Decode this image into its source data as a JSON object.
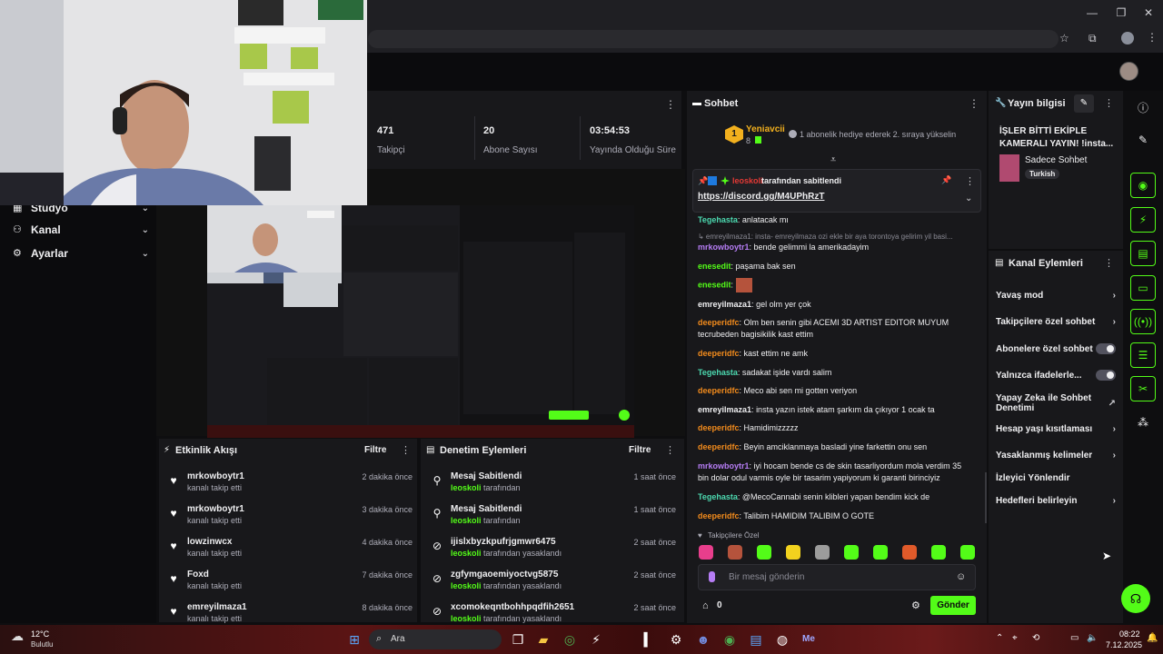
{
  "stats": [
    {
      "value": "471",
      "label": "Takipçi"
    },
    {
      "value": "20",
      "label": "Abone Sayısı"
    },
    {
      "value": "03:54:53",
      "label": "Yayında Olduğu Süre"
    }
  ],
  "sidebar": {
    "items": [
      {
        "label": "Stüdyo",
        "icon": "studio-icon"
      },
      {
        "label": "Kanal",
        "icon": "channel-icon"
      },
      {
        "label": "Ayarlar",
        "icon": "gear-icon"
      }
    ]
  },
  "activity": {
    "title": "Etkinlik Akışı",
    "filter": "Filtre",
    "rows": [
      {
        "user": "mrkowboytr1",
        "desc": "kanalı takip etti",
        "time": "2 dakika önce"
      },
      {
        "user": "mrkowboytr1",
        "desc": "kanalı takip etti",
        "time": "3 dakika önce"
      },
      {
        "user": "lowzinwcx",
        "desc": "kanalı takip etti",
        "time": "4 dakika önce"
      },
      {
        "user": "Foxd",
        "desc": "kanalı takip etti",
        "time": "7 dakika önce"
      },
      {
        "user": "emreyilmaza1",
        "desc": "kanalı takip etti",
        "time": "8 dakika önce"
      }
    ]
  },
  "moderation": {
    "title": "Denetim Eylemleri",
    "filter": "Filtre",
    "rows": [
      {
        "title": "Mesaj Sabitlendi",
        "by": "leoskoli",
        "suffix": "tarafından",
        "time": "1 saat önce",
        "icon": "pin-icon"
      },
      {
        "title": "Mesaj Sabitlendi",
        "by": "leoskoli",
        "suffix": "tarafından",
        "time": "1 saat önce",
        "icon": "pin-icon"
      },
      {
        "title": "ijislxbyzkpufrjgmwr6475",
        "by": "leoskoli",
        "suffix": "tarafından yasaklandı",
        "time": "2 saat önce",
        "icon": "ban-icon"
      },
      {
        "title": "zgfymgaoemiyoctvg5875",
        "by": "leoskoli",
        "suffix": "tarafından yasaklandı",
        "time": "2 saat önce",
        "icon": "ban-icon"
      },
      {
        "title": "xcomokeqntbohhpqdfih2651",
        "by": "leoskoli",
        "suffix": "tarafından yasaklandı",
        "time": "2 saat önce",
        "icon": "ban-icon"
      }
    ]
  },
  "chat": {
    "title": "Sohbet",
    "leader": {
      "rank": "1",
      "name": "Yeniavcii",
      "count": "8",
      "note": "1 abonelik hediye ederek 2. sıraya yükselin"
    },
    "pinned": {
      "by": "leoskoli",
      "label": "tarafından sabitlendi",
      "link": "https://discord.gg/M4UPhRzT"
    },
    "messages": [
      {
        "user": "Tegehasta",
        "color": "teal",
        "text": "anlatacak mı"
      },
      {
        "user": "",
        "color": "reply",
        "text": "↳ emreyilmaza1: insta- emreyilmaza ozi ekle bir aya torontoya gelirim yil basi..."
      },
      {
        "user": "mrkowboytr1",
        "color": "purple",
        "text": "bende gelimmi la amerikadayim"
      },
      {
        "user": "enesedit",
        "color": "green",
        "text": "paşama bak sen"
      },
      {
        "user": "enesedit",
        "color": "green",
        "text": ""
      },
      {
        "user": "emreyilmaza1",
        "color": "white",
        "text": "gel olm yer çok"
      },
      {
        "user": "deeperidfc",
        "color": "orange",
        "text": "Olm ben senin gibi ACEMI 3D ARTIST EDITOR MUYUM tecrubeden bagisikilik kast ettim"
      },
      {
        "user": "deeperidfc",
        "color": "orange",
        "text": "kast ettim ne amk"
      },
      {
        "user": "Tegehasta",
        "color": "teal",
        "text": "sadakat işide vardı salim"
      },
      {
        "user": "deeperidfc",
        "color": "orange",
        "text": "Meco abi sen mi gotten veriyon"
      },
      {
        "user": "emreyilmaza1",
        "color": "white",
        "text": "insta yazın istek atam şarkım da çıkıyor 1 ocak ta"
      },
      {
        "user": "deeperidfc",
        "color": "orange",
        "text": "Hamidimizzzzz"
      },
      {
        "user": "deeperidfc",
        "color": "orange",
        "text": "Beyin amciklanmaya basladi yine farkettin onu sen"
      },
      {
        "user": "mrkowboytr1",
        "color": "purple",
        "text": "iyi hocam bende cs de skin tasarliyordum mola verdim 35 bin dolar odul varmis oyle bir tasarim yapiyorum ki garanti birinciyiz"
      },
      {
        "user": "Tegehasta",
        "color": "teal",
        "text": "@MecoCannabi senin klibleri yapan bendim kick de"
      },
      {
        "user": "deeperidfc",
        "color": "orange",
        "text": "Talibim HAMIDIM TALIBIM O GOTE"
      }
    ],
    "emote_label": "Takipçilere Özel",
    "input_placeholder": "Bir mesaj gönderin",
    "points": "0",
    "send": "Gönder"
  },
  "info": {
    "title": "Yayın bilgisi",
    "stream_title": "İŞLER BİTTİ EKİPLE KAMERALI YAYIN! !insta...",
    "category": "Sadece Sohbet",
    "language": "Turkish"
  },
  "actions": {
    "title": "Kanal Eylemleri",
    "items": [
      {
        "label": "Yavaş mod",
        "kind": "arrow"
      },
      {
        "label": "Takipçilere özel sohbet",
        "kind": "arrow"
      },
      {
        "label": "Abonelere özel sohbet",
        "kind": "toggle"
      },
      {
        "label": "Yalnızca ifadelerle...",
        "kind": "toggle"
      },
      {
        "label": "Yapay Zeka ile Sohbet Denetimi",
        "kind": "external"
      },
      {
        "label": "Hesap yaşı kısıtlaması",
        "kind": "arrow"
      },
      {
        "label": "Yasaklanmış kelimeler",
        "kind": "arrow"
      },
      {
        "label": "İzleyici Yönlendir",
        "kind": "none"
      },
      {
        "label": "Hedefleri belirleyin",
        "kind": "arrow"
      }
    ]
  },
  "taskbar": {
    "weather_temp": "12°C",
    "weather_desc": "Bulutlu",
    "search": "Ara",
    "time": "08:22",
    "date": "7.12.2025"
  },
  "colors": {
    "accent": "#53fc18",
    "panel": "#18181b",
    "bg": "#0e0e10"
  }
}
